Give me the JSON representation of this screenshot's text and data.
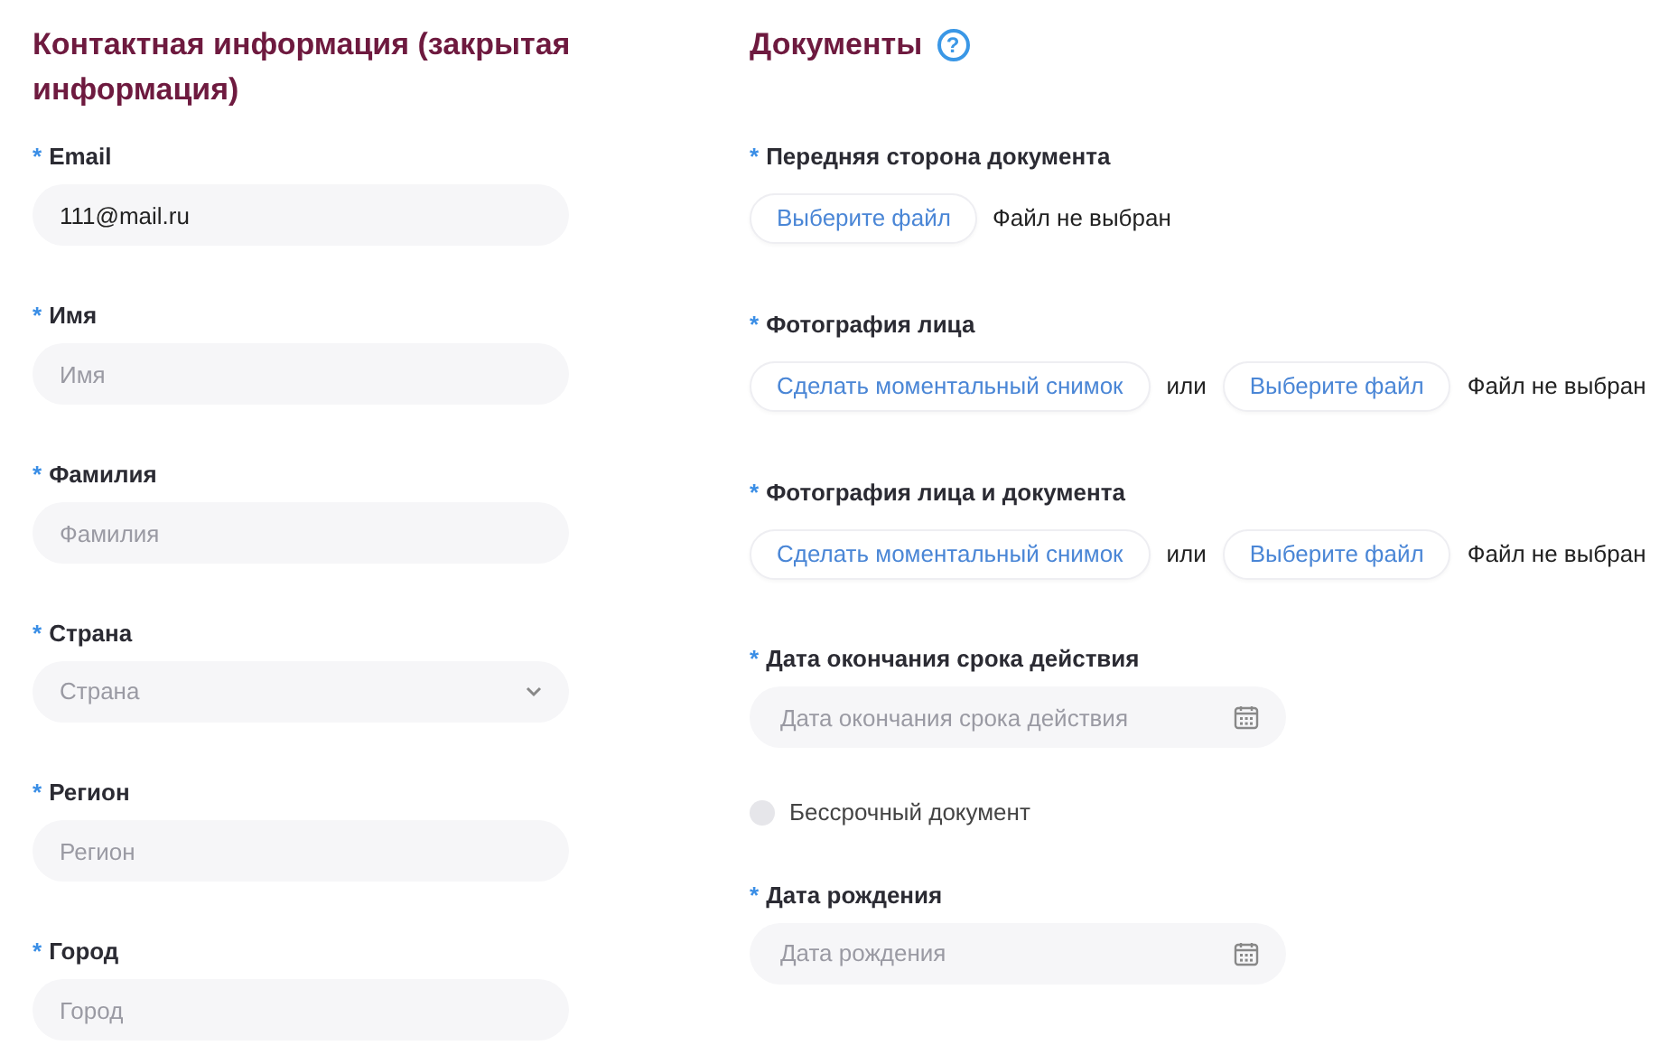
{
  "contact": {
    "title": "Контактная информация (закрытая информация)",
    "fields": [
      {
        "kind": "text",
        "mark": "*",
        "label": "Email",
        "value": "111@mail.ru"
      },
      {
        "kind": "text",
        "mark": "*",
        "label": "Имя",
        "placeholder": "Имя"
      },
      {
        "kind": "text",
        "mark": "*",
        "label": "Фамилия",
        "placeholder": "Фамилия"
      },
      {
        "kind": "select",
        "mark": "*",
        "label": "Страна",
        "placeholder": "Страна"
      },
      {
        "kind": "text",
        "mark": "*",
        "label": "Регион",
        "placeholder": "Регион"
      },
      {
        "kind": "text",
        "mark": "*",
        "label": "Город",
        "placeholder": "Город"
      }
    ]
  },
  "documents": {
    "title": "Документы",
    "help": "?",
    "fields": [
      {
        "kind": "file",
        "mark": "*",
        "label": "Передняя сторона документа",
        "file_button": "Выберите файл",
        "file_status": "Файл не выбран"
      },
      {
        "kind": "photo",
        "mark": "*",
        "label": "Фотография лица",
        "snapshot_button": "Сделать моментальный снимок",
        "or": "или",
        "file_button": "Выберите файл",
        "file_status": "Файл не выбран"
      },
      {
        "kind": "photo",
        "mark": "*",
        "label": "Фотография лица и документа",
        "snapshot_button": "Сделать моментальный снимок",
        "or": "или",
        "file_button": "Выберите файл",
        "file_status": "Файл не выбран"
      },
      {
        "kind": "date",
        "mark": "*",
        "label": "Дата окончания срока действия",
        "placeholder": "Дата окончания срока действия"
      },
      {
        "kind": "checkbox",
        "label": "Бессрочный документ",
        "checked": false
      },
      {
        "kind": "date",
        "mark": "*",
        "label": "Дата рождения",
        "placeholder": "Дата рождения"
      }
    ]
  }
}
